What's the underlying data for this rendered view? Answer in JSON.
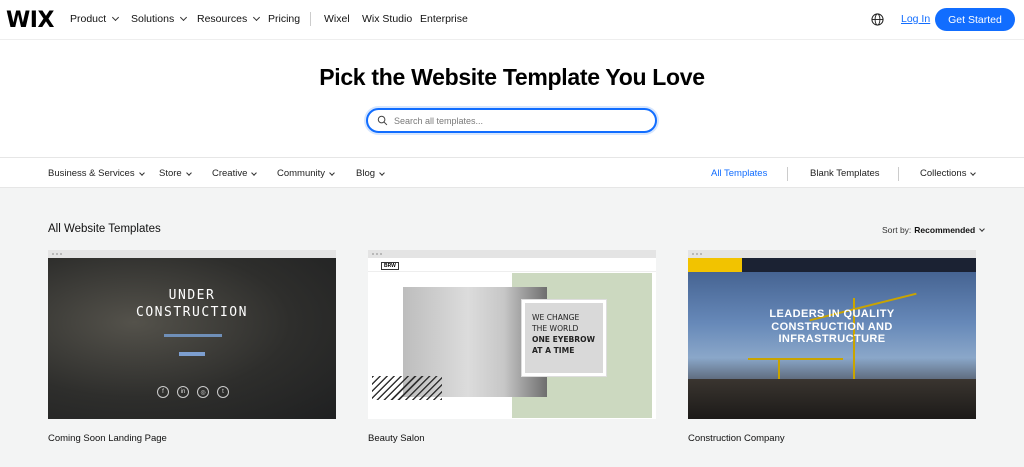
{
  "brand": "WIX",
  "nav": {
    "items": [
      {
        "label": "Product",
        "dropdown": true
      },
      {
        "label": "Solutions",
        "dropdown": true
      },
      {
        "label": "Resources",
        "dropdown": true
      },
      {
        "label": "Pricing",
        "dropdown": false
      },
      {
        "label": "Wixel",
        "dropdown": false
      },
      {
        "label": "Wix Studio",
        "dropdown": false
      },
      {
        "label": "Enterprise",
        "dropdown": false
      }
    ],
    "login": "Log In",
    "get_started": "Get Started"
  },
  "hero": {
    "title": "Pick the Website Template You Love",
    "search_placeholder": "Search all templates..."
  },
  "categories": {
    "left": [
      "Business & Services",
      "Store",
      "Creative",
      "Community",
      "Blog"
    ],
    "right": [
      {
        "label": "All Templates",
        "active": true
      },
      {
        "label": "Blank Templates",
        "active": false
      },
      {
        "label": "Collections",
        "active": false
      }
    ]
  },
  "gallery": {
    "title": "All Website Templates",
    "sort_label": "Sort by:",
    "sort_value": "Recommended",
    "cards": [
      {
        "title": "Coming Soon Landing Page",
        "thumb": {
          "line1": "UNDER",
          "line2": "CONSTRUCTION"
        }
      },
      {
        "title": "Beauty Salon",
        "thumb": {
          "logo": "BRW",
          "lines": [
            "WE CHANGE",
            "THE WORLD",
            "ONE EYEBROW",
            "AT A TIME"
          ]
        }
      },
      {
        "title": "Construction Company",
        "thumb": {
          "lines": [
            "LEADERS IN QUALITY",
            "CONSTRUCTION AND",
            "INFRASTRUCTURE"
          ]
        }
      }
    ]
  },
  "colors": {
    "accent": "#116dff",
    "gallery_bg": "#f3f4f4",
    "salon_green": "#ccd9c0",
    "construction_yellow": "#f2c300"
  }
}
